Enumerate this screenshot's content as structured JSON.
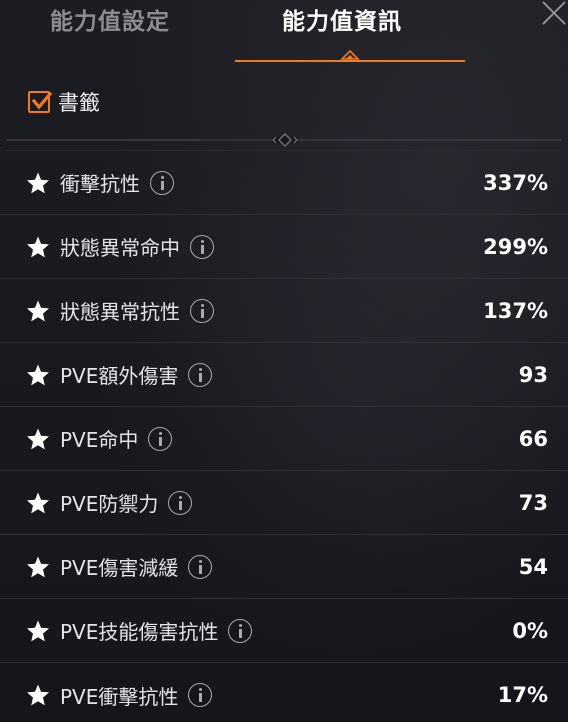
{
  "tabs": [
    {
      "label": "能力值設定",
      "active": false
    },
    {
      "label": "能力值資訊",
      "active": true
    }
  ],
  "accent_color": "#f07a1d",
  "bookmark": {
    "label": "書籤",
    "checked": true
  },
  "stats": [
    {
      "label": "衝擊抗性",
      "value": "337%"
    },
    {
      "label": "狀態異常命中",
      "value": "299%"
    },
    {
      "label": "狀態異常抗性",
      "value": "137%"
    },
    {
      "label": "PVE額外傷害",
      "value": "93"
    },
    {
      "label": "PVE命中",
      "value": "66"
    },
    {
      "label": "PVE防禦力",
      "value": "73"
    },
    {
      "label": "PVE傷害減緩",
      "value": "54"
    },
    {
      "label": "PVE技能傷害抗性",
      "value": "0%"
    },
    {
      "label": "PVE衝擊抗性",
      "value": "17%"
    }
  ]
}
